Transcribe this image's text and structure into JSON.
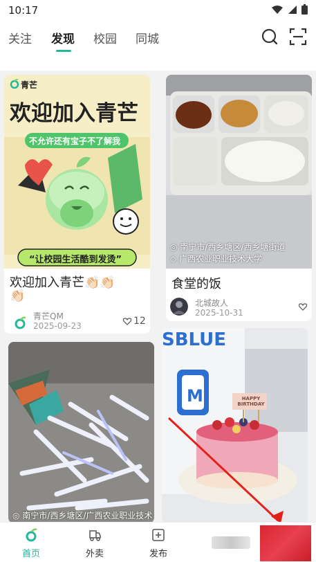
{
  "status": {
    "time": "10:17"
  },
  "tabs": [
    {
      "label": "关注",
      "active": false
    },
    {
      "label": "发现",
      "active": true
    },
    {
      "label": "校园",
      "active": false
    },
    {
      "label": "同城",
      "active": false
    }
  ],
  "icons": {
    "search": "search-icon",
    "scan": "scan-icon"
  },
  "accent": "#23b89a",
  "cards": [
    {
      "banner_brand": "青芒",
      "banner_headline": "欢迎加入青芒",
      "banner_sub": "不允许还有宝子不了解我",
      "banner_slogan": "“让校园生活酷到发烫”",
      "title_line1": "欢迎加入青芒👏🏻👏🏻",
      "title_line2": "👏🏻",
      "author": "青芒QM",
      "date": "2025-09-23",
      "likes": "12"
    },
    {
      "location1": "◎ 南宁市/西乡塘区/西乡塘街道",
      "location2": "◇ 广西农业职业技术大学",
      "title": "食堂的饭",
      "author": "北城故人",
      "date": "2025-10-31"
    },
    {
      "location1": "◎ 南宁市/西乡塘区/广西农业职业技术"
    },
    {
      "bag_text": "SBLUE",
      "bag_letter": "M",
      "cake_topper": "HAPPY BIRTHDAY"
    }
  ],
  "bottom_nav": [
    {
      "label": "首页",
      "icon": "home-icon",
      "active": true
    },
    {
      "label": "外卖",
      "icon": "delivery-icon",
      "active": false
    },
    {
      "label": "发布",
      "icon": "plus-square-icon",
      "active": false
    }
  ]
}
